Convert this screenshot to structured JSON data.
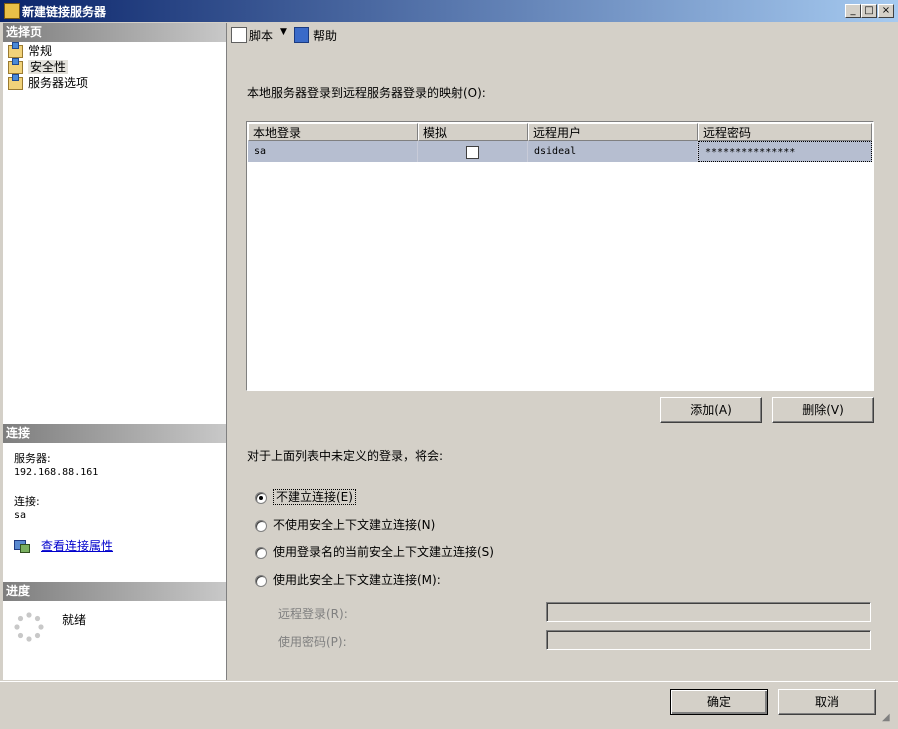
{
  "window": {
    "title": "新建链接服务器",
    "min": "_",
    "max": "□",
    "close": "×"
  },
  "left": {
    "select_page_header": "选择页",
    "pages": [
      {
        "label": "常规"
      },
      {
        "label": "安全性"
      },
      {
        "label": "服务器选项"
      }
    ],
    "connection_header": "连接",
    "server_label": "服务器:",
    "server_value": "192.168.88.161",
    "connection_label": "连接:",
    "connection_value": "sa",
    "view_props_link": "查看连接属性",
    "progress_header": "进度",
    "progress_status": "就绪"
  },
  "toolbar": {
    "script_label": "脚本",
    "help_label": "帮助"
  },
  "security": {
    "mapping_label": "本地服务器登录到远程服务器登录的映射(O):",
    "columns": [
      "本地登录",
      "模拟",
      "远程用户",
      "远程密码"
    ],
    "rows": [
      {
        "local_login": "sa",
        "impersonate": false,
        "remote_user": "dsideal",
        "remote_password": "***************"
      }
    ],
    "add_button": "添加(A)",
    "remove_button": "删除(V)",
    "undefined_label": "对于上面列表中未定义的登录，将会:",
    "options": [
      {
        "label": "不建立连接(E)",
        "selected": true
      },
      {
        "label": "不使用安全上下文建立连接(N)",
        "selected": false
      },
      {
        "label": "使用登录名的当前安全上下文建立连接(S)",
        "selected": false
      },
      {
        "label": "使用此安全上下文建立连接(M):",
        "selected": false
      }
    ],
    "remote_login_label": "远程登录(R):",
    "remote_login_value": "",
    "password_label": "使用密码(P):",
    "password_value": ""
  },
  "footer": {
    "ok_button": "确定",
    "cancel_button": "取消"
  }
}
